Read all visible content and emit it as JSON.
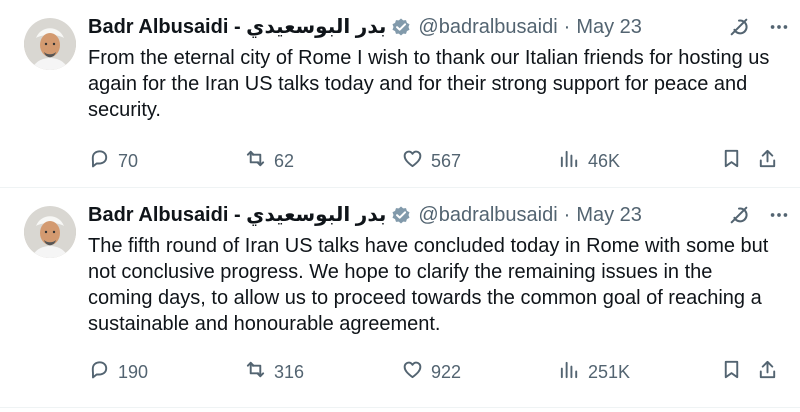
{
  "tweets": [
    {
      "author": {
        "display_name": "Badr Albusaidi - بدر البوسعيدي",
        "handle": "@badralbusaidi",
        "verified_icon": "verified-badge-icon",
        "avatar_icon": "profile-avatar"
      },
      "separator": "·",
      "date": "May 23",
      "text": "From the eternal city of Rome I wish to thank our Italian friends for hosting us again for the Iran US talks today and for their strong support for peace and security.",
      "metrics": {
        "replies": "70",
        "reposts": "62",
        "likes": "567",
        "views": "46K"
      },
      "icons": {
        "grok": "grok-icon",
        "more": "more-options-icon",
        "reply": "reply-icon",
        "repost": "repost-icon",
        "like": "like-icon",
        "views": "views-icon",
        "bookmark": "bookmark-icon",
        "share": "share-icon"
      }
    },
    {
      "author": {
        "display_name": "Badr Albusaidi - بدر البوسعيدي",
        "handle": "@badralbusaidi",
        "verified_icon": "verified-badge-icon",
        "avatar_icon": "profile-avatar"
      },
      "separator": "·",
      "date": "May 23",
      "text": "The fifth round of Iran US talks have concluded today in Rome with some but not conclusive progress. We hope to clarify the remaining issues in the coming days, to allow us to proceed towards the common goal of reaching a sustainable and honourable agreement.",
      "metrics": {
        "replies": "190",
        "reposts": "316",
        "likes": "922",
        "views": "251K"
      },
      "icons": {
        "grok": "grok-icon",
        "more": "more-options-icon",
        "reply": "reply-icon",
        "repost": "repost-icon",
        "like": "like-icon",
        "views": "views-icon",
        "bookmark": "bookmark-icon",
        "share": "share-icon"
      }
    }
  ],
  "colors": {
    "text": "#0f1419",
    "secondary": "#536471",
    "divider": "#eff3f4",
    "verified_badge": "#829aab"
  }
}
